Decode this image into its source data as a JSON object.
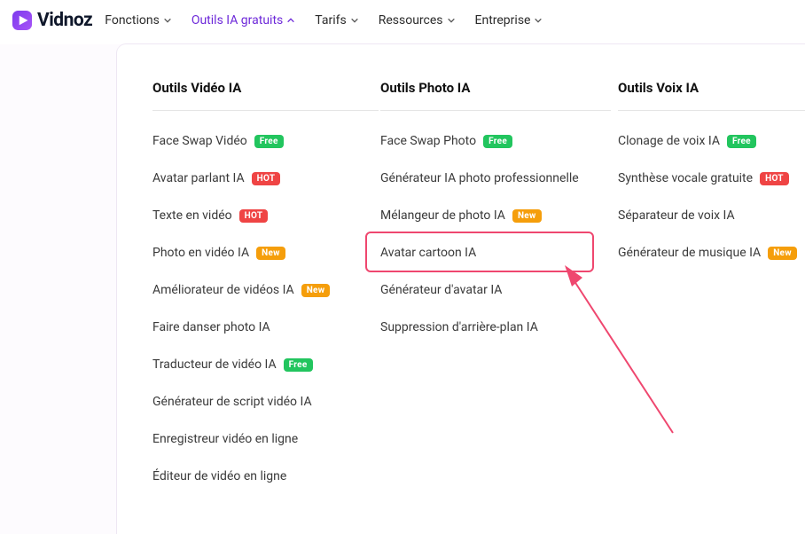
{
  "logo": {
    "text": "Vidnoz"
  },
  "nav": {
    "fonctions": {
      "label": "Fonctions"
    },
    "outils_ia": {
      "label": "Outils IA gratuits"
    },
    "tarifs": {
      "label": "Tarifs"
    },
    "ressources": {
      "label": "Ressources"
    },
    "entreprise": {
      "label": "Entreprise"
    }
  },
  "dropdown": {
    "video": {
      "title": "Outils Vidéo IA",
      "items": [
        {
          "label": "Face Swap Vidéo",
          "badge": "Free"
        },
        {
          "label": "Avatar parlant IA",
          "badge": "HOT"
        },
        {
          "label": "Texte en vidéo",
          "badge": "HOT"
        },
        {
          "label": "Photo en vidéo IA",
          "badge": "New"
        },
        {
          "label": "Améliorateur de vidéos IA",
          "badge": "New"
        },
        {
          "label": "Faire danser photo IA"
        },
        {
          "label": "Traducteur de vidéo IA",
          "badge": "Free"
        },
        {
          "label": "Générateur de script vidéo IA"
        },
        {
          "label": "Enregistreur vidéo en ligne"
        },
        {
          "label": "Éditeur de vidéo en ligne"
        }
      ]
    },
    "photo": {
      "title": "Outils Photo IA",
      "items": [
        {
          "label": "Face Swap Photo",
          "badge": "Free"
        },
        {
          "label": "Générateur IA photo professionnelle"
        },
        {
          "label": "Mélangeur de photo IA",
          "badge": "New"
        },
        {
          "label": "Avatar cartoon IA"
        },
        {
          "label": "Générateur d'avatar IA"
        },
        {
          "label": "Suppression d'arrière-plan IA"
        }
      ]
    },
    "voix": {
      "title": "Outils Voix IA",
      "items": [
        {
          "label": "Clonage de voix IA",
          "badge": "Free"
        },
        {
          "label": "Synthèse vocale gratuite",
          "badge": "HOT"
        },
        {
          "label": "Séparateur de voix IA"
        },
        {
          "label": "Générateur de musique IA",
          "badge": "New"
        }
      ]
    }
  },
  "badges": {
    "free": "Free",
    "hot": "HOT",
    "new": "New"
  }
}
